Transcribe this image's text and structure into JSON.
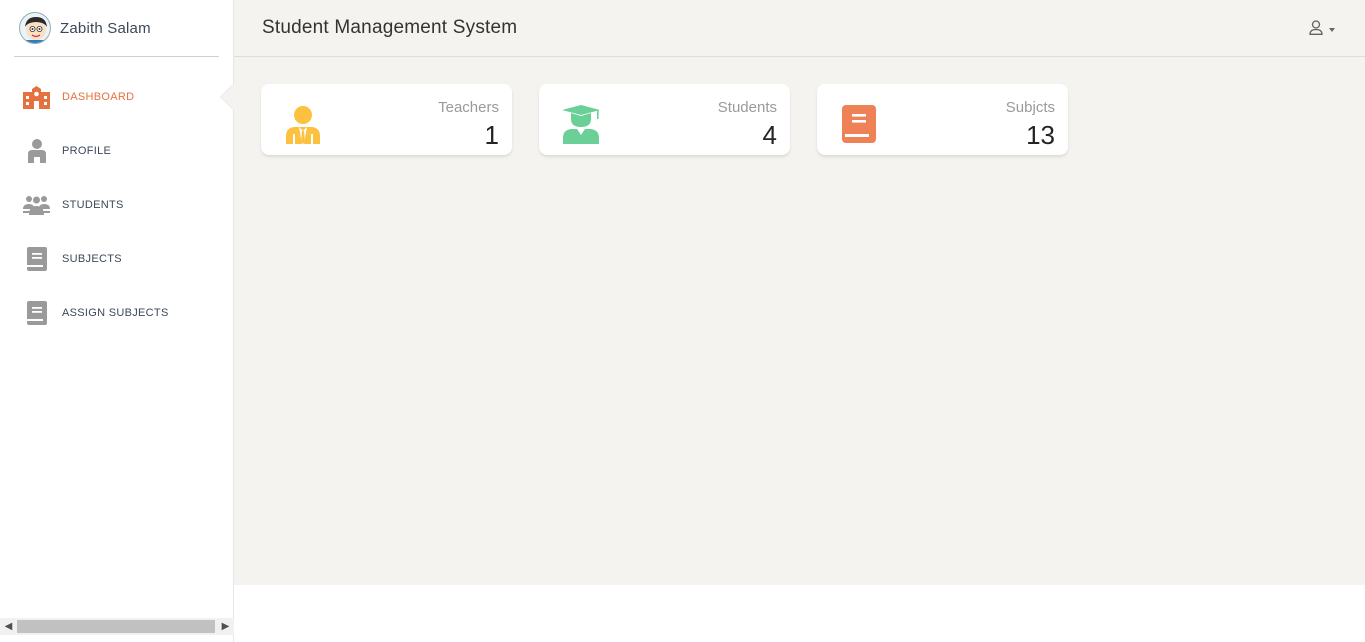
{
  "user": {
    "name": "Zabith Salam"
  },
  "sidebar": {
    "items": [
      {
        "label": "DASHBOARD",
        "icon": "school-icon",
        "active": true
      },
      {
        "label": "PROFILE",
        "icon": "person-icon",
        "active": false
      },
      {
        "label": "STUDENTS",
        "icon": "users-icon",
        "active": false
      },
      {
        "label": "SUBJECTS",
        "icon": "book-icon",
        "active": false
      },
      {
        "label": "ASSIGN SUBJECTS",
        "icon": "book-icon",
        "active": false
      }
    ]
  },
  "header": {
    "title": "Student Management System",
    "user_menu_icon": "user-icon"
  },
  "cards": [
    {
      "title": "Teachers",
      "value": "1",
      "icon": "teacher-icon",
      "color": "#fcc13e"
    },
    {
      "title": "Students",
      "value": "4",
      "icon": "graduate-icon",
      "color": "#6bd098"
    },
    {
      "title": "Subjcts",
      "value": "13",
      "icon": "book-icon",
      "color": "#ef8157"
    }
  ],
  "colors": {
    "accent": "#e5713e",
    "background": "#f4f3ef",
    "nav_icon": "#9a9a9a"
  }
}
